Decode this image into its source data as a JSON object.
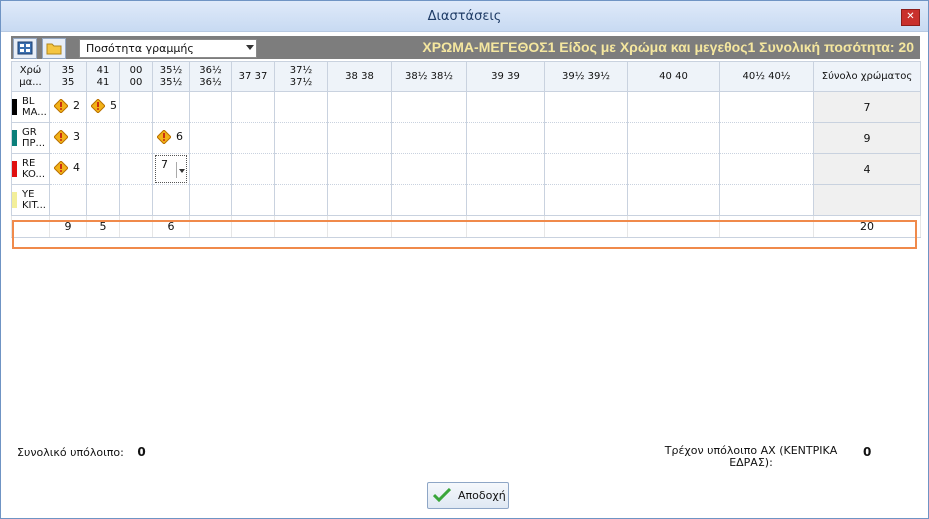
{
  "window": {
    "title": "Διαστάσεις",
    "close_glyph": "✕"
  },
  "toolbar": {
    "mode_select": "Ποσότητα γραμμής",
    "title": "ΧΡΩΜΑ-ΜΕΓΕΘΟΣ1 Είδος με Χρώμα και μεγεθος1 Συνολική ποσότητα: 20",
    "icons": [
      "grid-icon",
      "folder-icon"
    ]
  },
  "grid": {
    "color_header": [
      "Χρώ",
      "μα..."
    ],
    "size_headers": [
      [
        "35",
        "35"
      ],
      [
        "41",
        "41"
      ],
      [
        "00",
        "00"
      ],
      [
        "35½",
        "35½"
      ],
      [
        "36½",
        "36½"
      ],
      [
        "37  37"
      ],
      [
        "37½",
        "37½"
      ],
      [
        "38  38"
      ],
      [
        "38½  38½"
      ],
      [
        "39  39"
      ],
      [
        "39½  39½"
      ],
      [
        "40  40"
      ],
      [
        "40½  40½"
      ]
    ],
    "total_header": "Σύνολο χρώματος",
    "rows": [
      {
        "code": "BL",
        "name": "MA...",
        "color": "#000000",
        "cells": [
          "2",
          "5",
          "",
          "",
          "",
          "",
          "",
          "",
          "",
          "",
          "",
          "",
          ""
        ],
        "total": "7"
      },
      {
        "code": "GR",
        "name": "ΠΡ...",
        "color": "#0b7f7a",
        "cells": [
          "3",
          "",
          "",
          "6",
          "",
          "",
          "",
          "",
          "",
          "",
          "",
          "",
          ""
        ],
        "total": "9"
      },
      {
        "code": "RE",
        "name": "KO...",
        "color": "#e01010",
        "cells": [
          "4",
          "",
          "",
          "7",
          "",
          "",
          "",
          "",
          "",
          "",
          "",
          "",
          ""
        ],
        "total": "4"
      },
      {
        "code": "YE",
        "name": "KIT...",
        "color": "#f3ef9a",
        "cells": [
          "",
          "",
          "",
          "",
          "",
          "",
          "",
          "",
          "",
          "",
          "",
          "",
          ""
        ],
        "total": ""
      }
    ],
    "sum_row": [
      "9",
      "5",
      "",
      "6",
      "",
      "",
      "",
      "",
      "",
      "",
      "",
      "",
      ""
    ],
    "sum_total": "20"
  },
  "footer": {
    "remaining_label": "Συνολικό υπόλοιπο:",
    "remaining_value": "0",
    "current_label": "Τρέχον υπόλοιπο ΑΧ (ΚΕΝΤΡΙΚΑ ΕΔΡΑΣ):",
    "current_value": "0",
    "accept_label": "Αποδοχή"
  },
  "colors": {
    "toolbar_bg": "#7d7d7d",
    "toolbar_title": "#f5e79f",
    "highlight": "#f08a4b"
  }
}
